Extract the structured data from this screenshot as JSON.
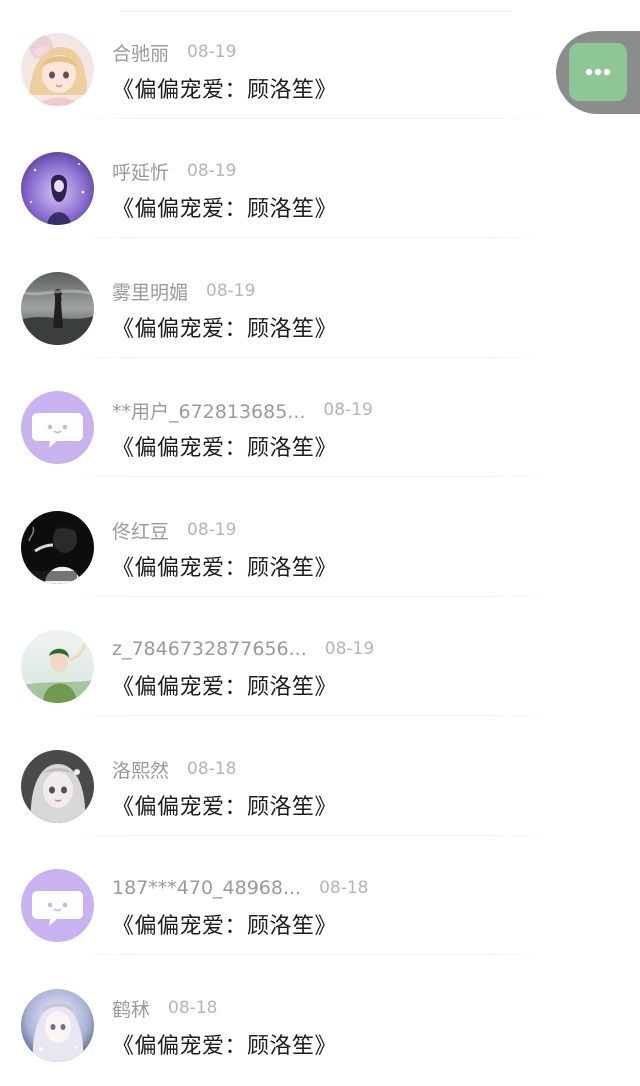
{
  "comments": [
    {
      "name": "合驰丽",
      "date": "08-19",
      "content": "《偏偏宠爱：顾洛笙》",
      "avatar": "anime-girl-blonde"
    },
    {
      "name": "呼延忻",
      "date": "08-19",
      "content": "《偏偏宠爱：顾洛笙》",
      "avatar": "purple-night-girl"
    },
    {
      "name": "雾里明媚",
      "date": "08-19",
      "content": "《偏偏宠爱：顾洛笙》",
      "avatar": "misty-figure"
    },
    {
      "name": "**用户_672813685...",
      "date": "08-19",
      "content": "《偏偏宠爱：顾洛笙》",
      "avatar": "default-chat-bubble"
    },
    {
      "name": "佟红豆",
      "date": "08-19",
      "content": "《偏偏宠爱：顾洛笙》",
      "avatar": "dark-man-smoking"
    },
    {
      "name": "z_7846732877656...",
      "date": "08-19",
      "content": "《偏偏宠爱：顾洛笙》",
      "avatar": "green-shirt-boy"
    },
    {
      "name": "洛熙然",
      "date": "08-18",
      "content": "《偏偏宠爱：顾洛笙》",
      "avatar": "doll-girl"
    },
    {
      "name": "187***470_48968...",
      "date": "08-18",
      "content": "《偏偏宠爱：顾洛笙》",
      "avatar": "default-chat-bubble"
    },
    {
      "name": "鹤秫",
      "date": "08-18",
      "content": "《偏偏宠爱：顾洛笙》",
      "avatar": "ethereal-girl"
    }
  ],
  "floating_button": {
    "icon": "more-dots-icon"
  },
  "colors": {
    "accent_green": "#8ec795",
    "default_avatar": "#c9b2f0",
    "name_gray": "#9a9a9a",
    "date_gray": "#b5b5b5",
    "content_dark": "#1c1c1c"
  }
}
